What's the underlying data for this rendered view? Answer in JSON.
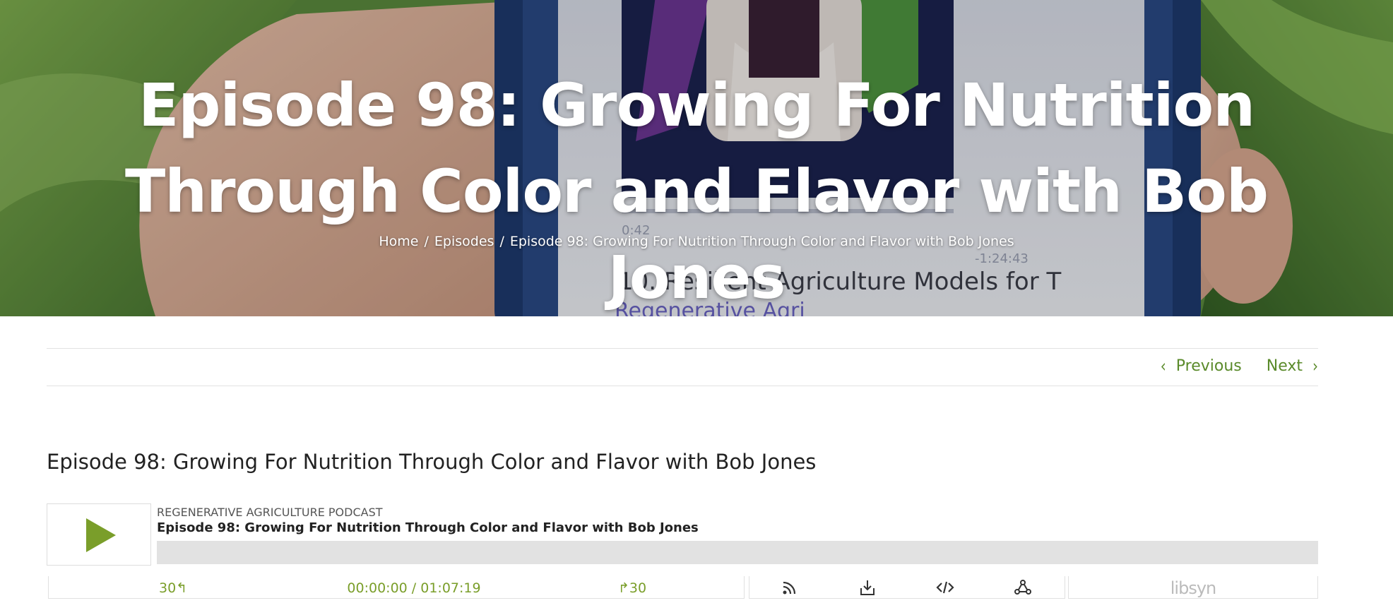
{
  "hero": {
    "title": "Episode 98: Growing For Nutrition Through Color and Flavor with Bob Jones",
    "breadcrumb": {
      "home": "Home",
      "episodes": "Episodes",
      "current": "Episode 98: Growing For Nutrition Through Color and Flavor with Bob Jones",
      "separator": "/"
    }
  },
  "post_nav": {
    "previous": "Previous",
    "next": "Next"
  },
  "post": {
    "title": "Episode 98: Growing For Nutrition Through Color and Flavor with Bob Jones"
  },
  "player": {
    "podcast_name": "REGENERATIVE AGRICULTURE PODCAST",
    "episode_name": "Episode 98: Growing For Nutrition Through Color and Flavor with Bob Jones",
    "progress_fraction": 0,
    "rewind_label": "30↰",
    "time_display": "00:00:00 / 01:07:19",
    "forward_label": "↱30",
    "brand": "libsyn",
    "icons": [
      "play-icon",
      "rss-icon",
      "download-icon",
      "embed-code-icon",
      "share-icon"
    ],
    "accent_color": "#7a9e2a"
  },
  "colors": {
    "link_green": "#5a8a2a",
    "progress_track": "#e2e2e2"
  }
}
